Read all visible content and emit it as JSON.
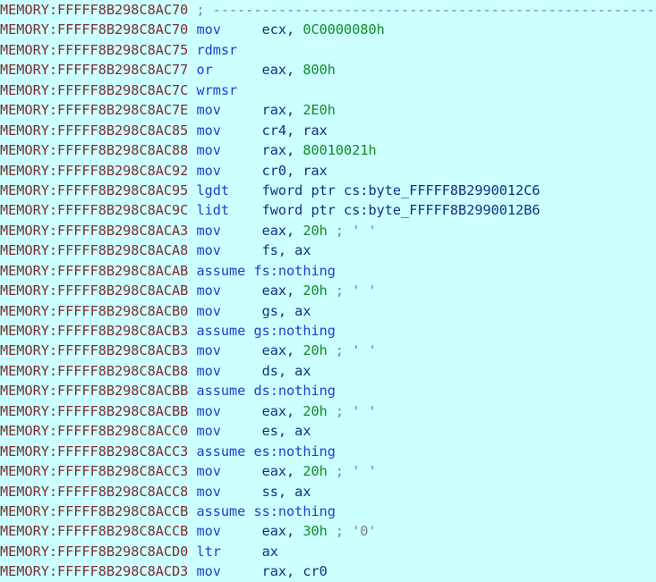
{
  "view": {
    "name": "IDA Pro disassembly listing",
    "segment_prefix": "MEMORY",
    "background_color": "#CCFFFF",
    "colors": {
      "address": "#7B2F2F",
      "mnemonic": "#1D3FCF",
      "operand": "#13307E",
      "number": "#0F8C22",
      "comment": "#808080",
      "assume": "#1D3FCF"
    }
  },
  "lines": [
    {
      "address": "MEMORY:FFFFF8B298C8AC70",
      "kind": "comment-separator",
      "comment": "; -----------------------------------------------------------"
    },
    {
      "address": "MEMORY:FFFFF8B298C8AC70",
      "kind": "instruction",
      "mnemonic": "mov",
      "operand_text": "ecx, ",
      "number": "0C0000080h",
      "operand_tail": "",
      "comment": ""
    },
    {
      "address": "MEMORY:FFFFF8B298C8AC75",
      "kind": "instruction",
      "mnemonic": "rdmsr",
      "operand_text": "",
      "number": "",
      "operand_tail": "",
      "comment": ""
    },
    {
      "address": "MEMORY:FFFFF8B298C8AC77",
      "kind": "instruction",
      "mnemonic": "or",
      "operand_text": "eax, ",
      "number": "800h",
      "operand_tail": "",
      "comment": ""
    },
    {
      "address": "MEMORY:FFFFF8B298C8AC7C",
      "kind": "instruction",
      "mnemonic": "wrmsr",
      "operand_text": "",
      "number": "",
      "operand_tail": "",
      "comment": ""
    },
    {
      "address": "MEMORY:FFFFF8B298C8AC7E",
      "kind": "instruction",
      "mnemonic": "mov",
      "operand_text": "rax, ",
      "number": "2E0h",
      "operand_tail": "",
      "comment": ""
    },
    {
      "address": "MEMORY:FFFFF8B298C8AC85",
      "kind": "instruction",
      "mnemonic": "mov",
      "operand_text": "cr4, rax",
      "number": "",
      "operand_tail": "",
      "comment": ""
    },
    {
      "address": "MEMORY:FFFFF8B298C8AC88",
      "kind": "instruction",
      "mnemonic": "mov",
      "operand_text": "rax, ",
      "number": "80010021h",
      "operand_tail": "",
      "comment": ""
    },
    {
      "address": "MEMORY:FFFFF8B298C8AC92",
      "kind": "instruction",
      "mnemonic": "mov",
      "operand_text": "cr0, rax",
      "number": "",
      "operand_tail": "",
      "comment": ""
    },
    {
      "address": "MEMORY:FFFFF8B298C8AC95",
      "kind": "instruction",
      "mnemonic": "lgdt",
      "operand_text": "fword ptr cs:byte_FFFFF8B2990012C6",
      "number": "",
      "operand_tail": "",
      "comment": ""
    },
    {
      "address": "MEMORY:FFFFF8B298C8AC9C",
      "kind": "instruction",
      "mnemonic": "lidt",
      "operand_text": "fword ptr cs:byte_FFFFF8B2990012B6",
      "number": "",
      "operand_tail": "",
      "comment": ""
    },
    {
      "address": "MEMORY:FFFFF8B298C8ACA3",
      "kind": "instruction",
      "mnemonic": "mov",
      "operand_text": "eax, ",
      "number": "20h",
      "operand_tail": "",
      "comment": "; ' '"
    },
    {
      "address": "MEMORY:FFFFF8B298C8ACA8",
      "kind": "instruction",
      "mnemonic": "mov",
      "operand_text": "fs, ax",
      "number": "",
      "operand_tail": "",
      "comment": ""
    },
    {
      "address": "MEMORY:FFFFF8B298C8ACAB",
      "kind": "assume",
      "assume_text": "assume fs:nothing"
    },
    {
      "address": "MEMORY:FFFFF8B298C8ACAB",
      "kind": "instruction",
      "mnemonic": "mov",
      "operand_text": "eax, ",
      "number": "20h",
      "operand_tail": "",
      "comment": "; ' '"
    },
    {
      "address": "MEMORY:FFFFF8B298C8ACB0",
      "kind": "instruction",
      "mnemonic": "mov",
      "operand_text": "gs, ax",
      "number": "",
      "operand_tail": "",
      "comment": ""
    },
    {
      "address": "MEMORY:FFFFF8B298C8ACB3",
      "kind": "assume",
      "assume_text": "assume gs:nothing"
    },
    {
      "address": "MEMORY:FFFFF8B298C8ACB3",
      "kind": "instruction",
      "mnemonic": "mov",
      "operand_text": "eax, ",
      "number": "20h",
      "operand_tail": "",
      "comment": "; ' '"
    },
    {
      "address": "MEMORY:FFFFF8B298C8ACB8",
      "kind": "instruction",
      "mnemonic": "mov",
      "operand_text": "ds, ax",
      "number": "",
      "operand_tail": "",
      "comment": ""
    },
    {
      "address": "MEMORY:FFFFF8B298C8ACBB",
      "kind": "assume",
      "assume_text": "assume ds:nothing"
    },
    {
      "address": "MEMORY:FFFFF8B298C8ACBB",
      "kind": "instruction",
      "mnemonic": "mov",
      "operand_text": "eax, ",
      "number": "20h",
      "operand_tail": "",
      "comment": "; ' '"
    },
    {
      "address": "MEMORY:FFFFF8B298C8ACC0",
      "kind": "instruction",
      "mnemonic": "mov",
      "operand_text": "es, ax",
      "number": "",
      "operand_tail": "",
      "comment": ""
    },
    {
      "address": "MEMORY:FFFFF8B298C8ACC3",
      "kind": "assume",
      "assume_text": "assume es:nothing"
    },
    {
      "address": "MEMORY:FFFFF8B298C8ACC3",
      "kind": "instruction",
      "mnemonic": "mov",
      "operand_text": "eax, ",
      "number": "20h",
      "operand_tail": "",
      "comment": "; ' '"
    },
    {
      "address": "MEMORY:FFFFF8B298C8ACC8",
      "kind": "instruction",
      "mnemonic": "mov",
      "operand_text": "ss, ax",
      "number": "",
      "operand_tail": "",
      "comment": ""
    },
    {
      "address": "MEMORY:FFFFF8B298C8ACCB",
      "kind": "assume",
      "assume_text": "assume ss:nothing"
    },
    {
      "address": "MEMORY:FFFFF8B298C8ACCB",
      "kind": "instruction",
      "mnemonic": "mov",
      "operand_text": "eax, ",
      "number": "30h",
      "operand_tail": "",
      "comment": "; '0'"
    },
    {
      "address": "MEMORY:FFFFF8B298C8ACD0",
      "kind": "instruction",
      "mnemonic": "ltr",
      "operand_text": "ax",
      "number": "",
      "operand_tail": "",
      "comment": ""
    },
    {
      "address": "MEMORY:FFFFF8B298C8ACD3",
      "kind": "instruction",
      "mnemonic": "mov",
      "operand_text": "rax, cr0",
      "number": "",
      "operand_tail": "",
      "comment": ""
    }
  ]
}
